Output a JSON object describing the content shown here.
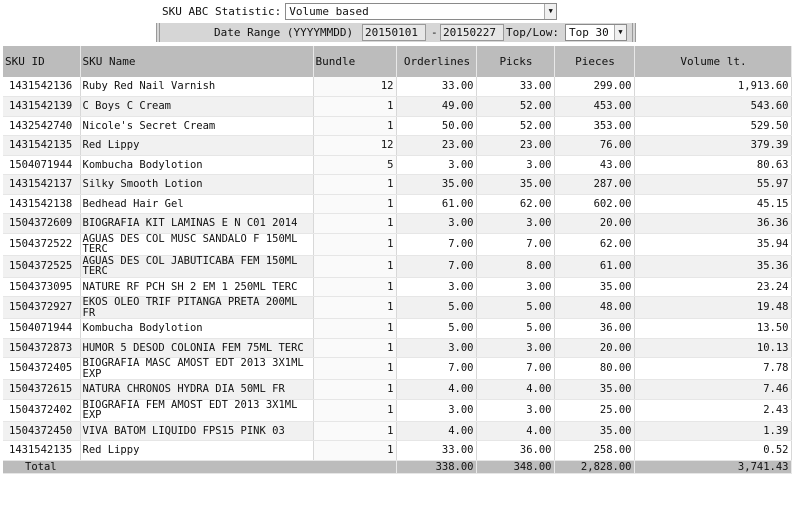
{
  "controls": {
    "statistic_label": "SKU ABC Statistic:",
    "statistic_value": "Volume based",
    "date_range_label": "Date Range (YYYYMMDD)",
    "date_from": "20150101",
    "date_sep": "-",
    "date_to": "20150227",
    "toplow_label": "Top/Low:",
    "toplow_value": "Top 30"
  },
  "table": {
    "headers": {
      "sku_id": "SKU ID",
      "sku_name": "SKU Name",
      "bundle": "Bundle",
      "orderlines": "Orderlines",
      "picks": "Picks",
      "pieces": "Pieces",
      "volume": "Volume lt."
    },
    "rows": [
      {
        "sku_id": "1431542136",
        "sku_name": "Ruby Red Nail Varnish",
        "bundle": "12",
        "orderlines": "33.00",
        "picks": "33.00",
        "pieces": "299.00",
        "volume": "1,913.60"
      },
      {
        "sku_id": "1431542139",
        "sku_name": "C Boys C Cream",
        "bundle": "1",
        "orderlines": "49.00",
        "picks": "52.00",
        "pieces": "453.00",
        "volume": "543.60"
      },
      {
        "sku_id": "1432542740",
        "sku_name": "Nicole's Secret Cream",
        "bundle": "1",
        "orderlines": "50.00",
        "picks": "52.00",
        "pieces": "353.00",
        "volume": "529.50"
      },
      {
        "sku_id": "1431542135",
        "sku_name": "Red Lippy",
        "bundle": "12",
        "orderlines": "23.00",
        "picks": "23.00",
        "pieces": "76.00",
        "volume": "379.39"
      },
      {
        "sku_id": "1504071944",
        "sku_name": "Kombucha Bodylotion",
        "bundle": "5",
        "orderlines": "3.00",
        "picks": "3.00",
        "pieces": "43.00",
        "volume": "80.63"
      },
      {
        "sku_id": "1431542137",
        "sku_name": "Silky Smooth Lotion",
        "bundle": "1",
        "orderlines": "35.00",
        "picks": "35.00",
        "pieces": "287.00",
        "volume": "55.97"
      },
      {
        "sku_id": "1431542138",
        "sku_name": "Bedhead Hair Gel",
        "bundle": "1",
        "orderlines": "61.00",
        "picks": "62.00",
        "pieces": "602.00",
        "volume": "45.15"
      },
      {
        "sku_id": "1504372609",
        "sku_name": "BIOGRAFIA KIT LAMINAS E N C01 2014",
        "bundle": "1",
        "orderlines": "3.00",
        "picks": "3.00",
        "pieces": "20.00",
        "volume": "36.36"
      },
      {
        "sku_id": "1504372522",
        "sku_name": "AGUAS DES COL MUSC SANDALO F 150ML TERC",
        "bundle": "1",
        "orderlines": "7.00",
        "picks": "7.00",
        "pieces": "62.00",
        "volume": "35.94"
      },
      {
        "sku_id": "1504372525",
        "sku_name": "AGUAS DES COL JABUTICABA FEM 150ML TERC",
        "bundle": "1",
        "orderlines": "7.00",
        "picks": "8.00",
        "pieces": "61.00",
        "volume": "35.36"
      },
      {
        "sku_id": "1504373095",
        "sku_name": "NATURE RF PCH SH 2 EM 1 250ML TERC",
        "bundle": "1",
        "orderlines": "3.00",
        "picks": "3.00",
        "pieces": "35.00",
        "volume": "23.24"
      },
      {
        "sku_id": "1504372927",
        "sku_name": "EKOS OLEO TRIF PITANGA PRETA 200ML FR",
        "bundle": "1",
        "orderlines": "5.00",
        "picks": "5.00",
        "pieces": "48.00",
        "volume": "19.48"
      },
      {
        "sku_id": "1504071944",
        "sku_name": "Kombucha Bodylotion",
        "bundle": "1",
        "orderlines": "5.00",
        "picks": "5.00",
        "pieces": "36.00",
        "volume": "13.50"
      },
      {
        "sku_id": "1504372873",
        "sku_name": "HUMOR 5 DESOD COLONIA FEM 75ML TERC",
        "bundle": "1",
        "orderlines": "3.00",
        "picks": "3.00",
        "pieces": "20.00",
        "volume": "10.13"
      },
      {
        "sku_id": "1504372405",
        "sku_name": "BIOGRAFIA MASC AMOST EDT 2013 3X1ML EXP",
        "bundle": "1",
        "orderlines": "7.00",
        "picks": "7.00",
        "pieces": "80.00",
        "volume": "7.78"
      },
      {
        "sku_id": "1504372615",
        "sku_name": "NATURA CHRONOS HYDRA DIA 50ML FR",
        "bundle": "1",
        "orderlines": "4.00",
        "picks": "4.00",
        "pieces": "35.00",
        "volume": "7.46"
      },
      {
        "sku_id": "1504372402",
        "sku_name": "BIOGRAFIA FEM AMOST EDT 2013 3X1ML EXP",
        "bundle": "1",
        "orderlines": "3.00",
        "picks": "3.00",
        "pieces": "25.00",
        "volume": "2.43"
      },
      {
        "sku_id": "1504372450",
        "sku_name": "VIVA BATOM LIQUIDO FPS15 PINK 03",
        "bundle": "1",
        "orderlines": "4.00",
        "picks": "4.00",
        "pieces": "35.00",
        "volume": "1.39"
      },
      {
        "sku_id": "1431542135",
        "sku_name": "Red Lippy",
        "bundle": "1",
        "orderlines": "33.00",
        "picks": "36.00",
        "pieces": "258.00",
        "volume": "0.52"
      }
    ],
    "total": {
      "label": "Total",
      "orderlines": "338.00",
      "picks": "348.00",
      "pieces": "2,828.00",
      "volume": "3,741.43"
    }
  }
}
